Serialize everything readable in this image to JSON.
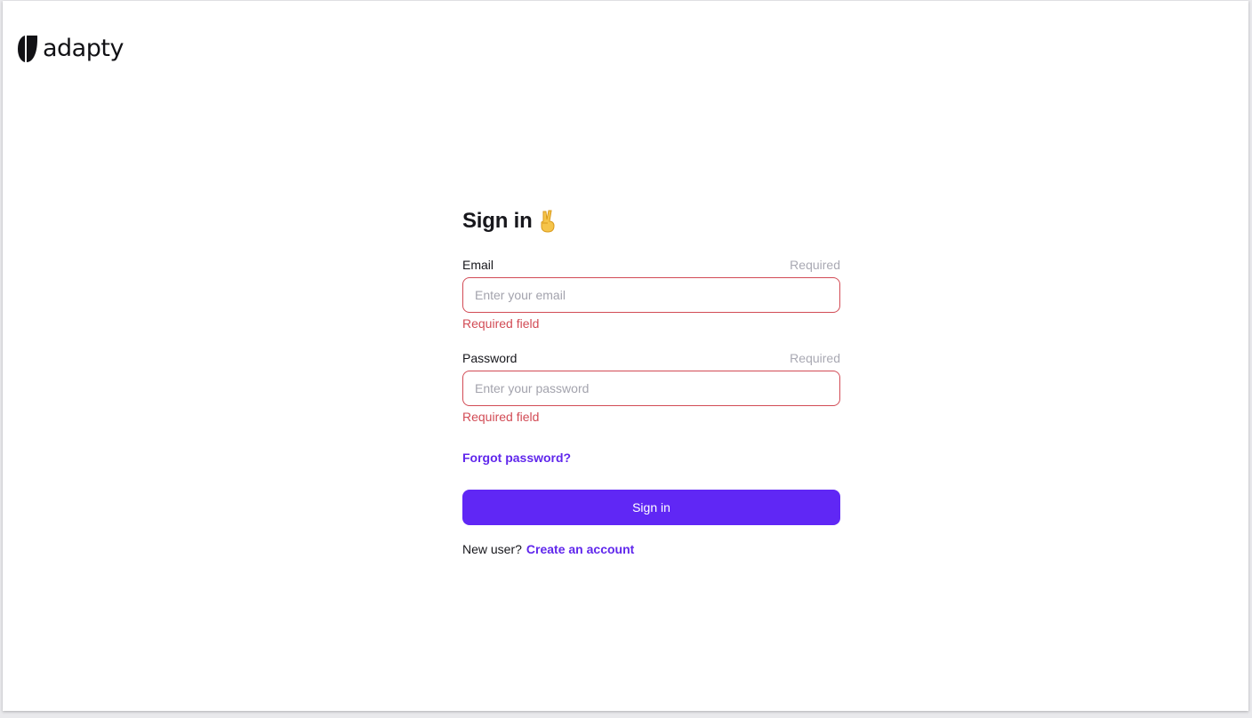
{
  "brand": {
    "name": "adapty",
    "logo_icon": "adapty-logo-mark"
  },
  "form": {
    "title": "Sign in",
    "title_icon": "victory-hand-icon",
    "email": {
      "label": "Email",
      "required_tag": "Required",
      "placeholder": "Enter your email",
      "value": "",
      "error": "Required field"
    },
    "password": {
      "label": "Password",
      "required_tag": "Required",
      "placeholder": "Enter your password",
      "value": "",
      "error": "Required field"
    },
    "forgot_link": "Forgot password?",
    "submit_label": "Sign in",
    "signup_prompt": "New user?",
    "signup_link": "Create an account"
  },
  "colors": {
    "accent": "#6027f5",
    "link": "#6027ec",
    "error": "#d24b55",
    "muted": "#a9a9b3"
  }
}
